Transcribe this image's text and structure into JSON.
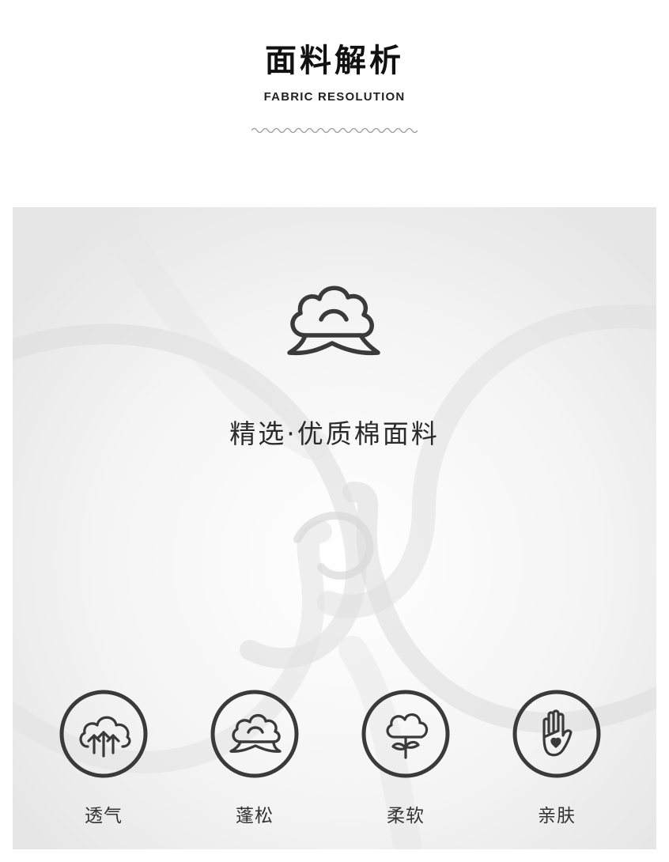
{
  "header": {
    "title": "面料解析",
    "subtitle": "FABRIC RESOLUTION"
  },
  "hero": {
    "icon": "cotton-boll-icon",
    "text": "精选·优质棉面料"
  },
  "features": [
    {
      "label": "透气",
      "icon": "cloud-arrows-icon"
    },
    {
      "label": "蓬松",
      "icon": "cotton-boll-icon"
    },
    {
      "label": "柔软",
      "icon": "cotton-flower-icon"
    },
    {
      "label": "亲肤",
      "icon": "hand-heart-icon"
    }
  ],
  "colors": {
    "ink": "#3a3a3a",
    "background": "#ffffff",
    "fabric": "#f3f3f3"
  }
}
